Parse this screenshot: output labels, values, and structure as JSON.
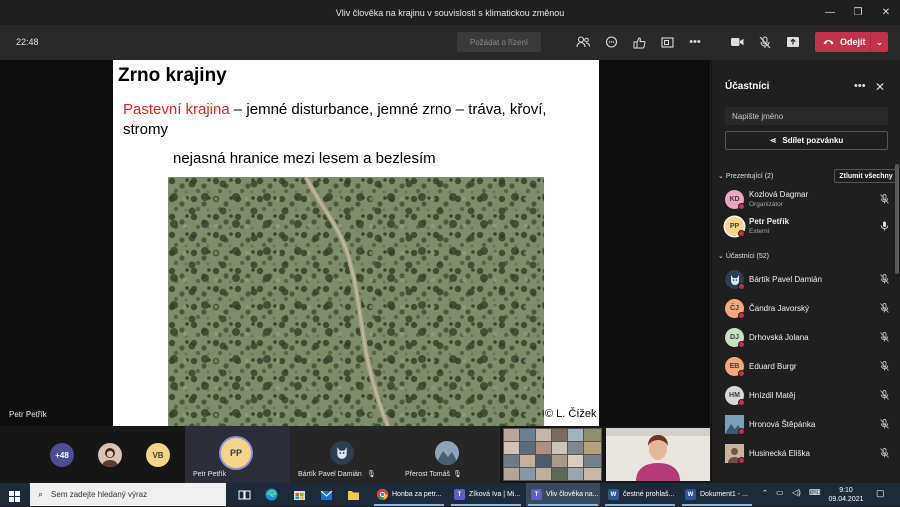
{
  "window": {
    "title": "Vliv člověka na krajinu v souvislosti s klimatickou změnou"
  },
  "toolbar": {
    "timer": "22:48",
    "raise_hand_label": "Požádat o řízení",
    "leave_label": "Odejít"
  },
  "slide": {
    "title": "Zrno krajiny",
    "line1_red": "Pastevní krajina",
    "line1_rest": " – jemné disturbance, jemné zrno – tráva, křoví, stromy",
    "line2": "nejasná hranice mezi lesem a bezlesím",
    "copyright": "© L. Čížek",
    "presenter": "Petr Petřík"
  },
  "panel": {
    "title": "Účastníci",
    "search_placeholder": "Napište jméno",
    "share_label": "Sdílet pozvánku",
    "presenters_header": "Prezentující (2)",
    "mute_all_label": "Ztlumit všechny",
    "attendees_header": "Účastníci (52)",
    "presenters": [
      {
        "initials": "KD",
        "name": "Kozlová Dagmar",
        "role": "Organizátor",
        "avatar_color": "#e6a8c3"
      },
      {
        "initials": "PP",
        "name": "Petr Petřík",
        "role": "Externí",
        "avatar_color": "#f3d58a"
      }
    ],
    "attendees": [
      {
        "initials": "",
        "name": "Bártík Pavel Damián",
        "avatar_color": "#2c3e50"
      },
      {
        "initials": "ČJ",
        "name": "Čandra Javorský",
        "avatar_color": "#f3a77f"
      },
      {
        "initials": "DJ",
        "name": "Drhovská Jolana",
        "avatar_color": "#c9dfc3"
      },
      {
        "initials": "EB",
        "name": "Eduard Burgr",
        "avatar_color": "#f3a77f"
      },
      {
        "initials": "HM",
        "name": "Hnízdil Matěj",
        "avatar_color": "#d8d8d8"
      },
      {
        "initials": "",
        "name": "Hronová Štěpánka",
        "avatar_color": "#5a7a9a"
      },
      {
        "initials": "",
        "name": "Husinecká Eliška",
        "avatar_color": "#b08a7a"
      }
    ]
  },
  "strip": {
    "overflow_count": "+48",
    "vb_initials": "VB",
    "pp_initials": "PP",
    "pp_name": "Petr Petřík",
    "bartik_name": "Bártík Pavel Damián",
    "prerost_name": "Přerost Tomáš"
  },
  "taskbar": {
    "search_placeholder": "Sem zadejte hledaný výraz",
    "apps": [
      {
        "label": "Honba za petr...",
        "icon": "chrome-icon"
      },
      {
        "label": "Zíková Iva | Mi...",
        "icon": "teams-icon"
      },
      {
        "label": "Vliv člověka na...",
        "icon": "teams-icon"
      },
      {
        "label": "čestné prohlaš...",
        "icon": "word-icon"
      },
      {
        "label": "Dokument1 - ...",
        "icon": "word-icon"
      }
    ],
    "time": "9:10",
    "date": "09.04.2021"
  },
  "colors": {
    "leave": "#c4314b",
    "slide_red": "#e0261f",
    "taskbar": "#1c2a3a"
  }
}
